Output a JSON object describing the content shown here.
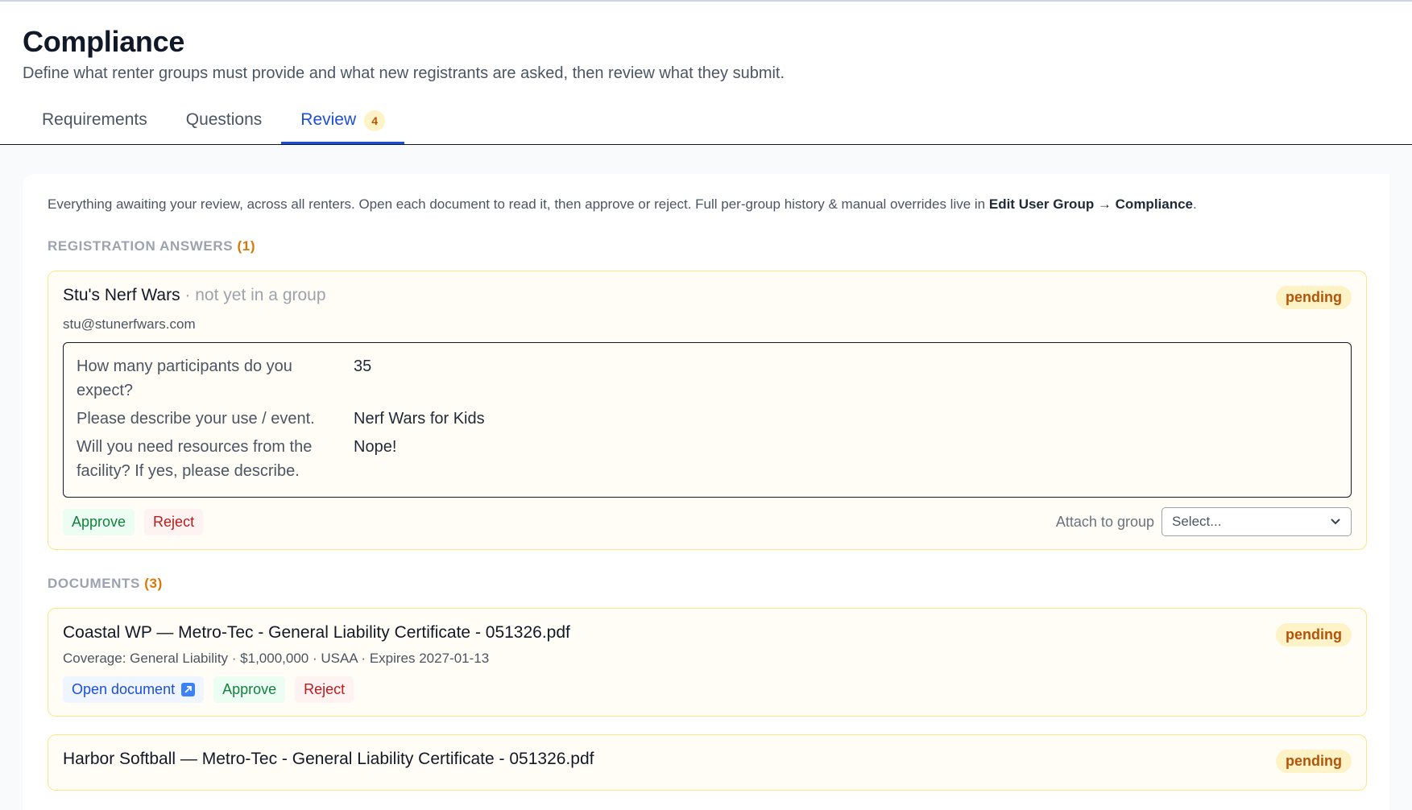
{
  "header": {
    "title": "Compliance",
    "subtitle": "Define what renter groups must provide and what new registrants are asked, then review what they submit."
  },
  "tabs": [
    {
      "label": "Requirements"
    },
    {
      "label": "Questions"
    },
    {
      "label": "Review",
      "badge": "4"
    }
  ],
  "intro": {
    "text": "Everything awaiting your review, across all renters. Open each document to read it, then approve or reject. Full per-group history & manual overrides live in ",
    "bold": "Edit User Group → Compliance",
    "end": "."
  },
  "registration": {
    "label": "REGISTRATION ANSWERS",
    "count": "(1)",
    "card": {
      "name": "Stu's Nerf Wars",
      "group_note": " · not yet in a group",
      "status": "pending",
      "email": "stu@stunerfwars.com",
      "qa": [
        {
          "q": "How many participants do you expect?",
          "a": "35"
        },
        {
          "q": "Please describe your use / event.",
          "a": "Nerf Wars for Kids"
        },
        {
          "q": "Will you need resources from the facility? If yes, please describe.",
          "a": "Nope!"
        }
      ],
      "approve": "Approve",
      "reject": "Reject",
      "attach_label": "Attach to group",
      "select_placeholder": "Select..."
    }
  },
  "documents": {
    "label": "DOCUMENTS",
    "count": "(3)",
    "items": [
      {
        "title": "Coastal WP — Metro-Tec - General Liability Certificate - 051326.pdf",
        "status": "pending",
        "meta": "Coverage: General Liability · $1,000,000 · USAA · Expires 2027-01-13",
        "open": "Open document",
        "approve": "Approve",
        "reject": "Reject"
      },
      {
        "title": "Harbor Softball — Metro-Tec - General Liability Certificate - 051326.pdf",
        "status": "pending"
      }
    ]
  }
}
